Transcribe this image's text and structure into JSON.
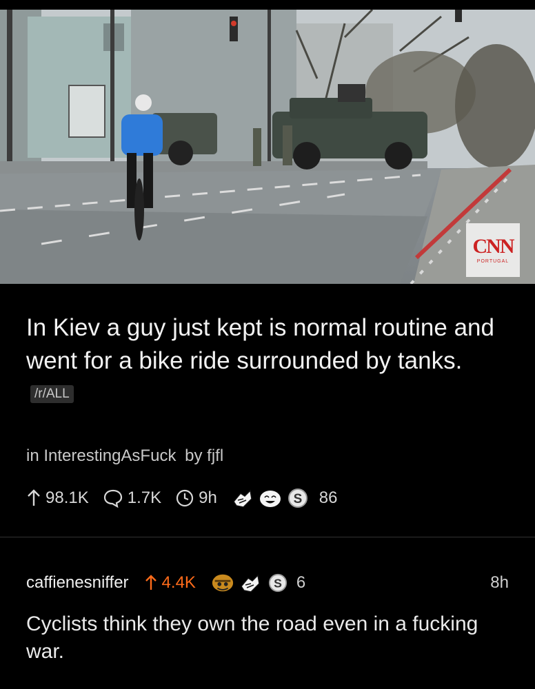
{
  "photo": {
    "watermark": {
      "logo": "CNN",
      "subtitle": "PORTUGAL"
    }
  },
  "post": {
    "title": "In Kiev a guy just kept is normal routine and went for a bike ride surrounded by tanks.",
    "flair": "/r/ALL",
    "subreddit_prefix": "in",
    "subreddit": "InterestingAsFuck",
    "author_prefix": "by",
    "author": "fjfl",
    "upvotes": "98.1K",
    "comments": "1.7K",
    "age": "9h",
    "awards": [
      "wholesome-hands-award-icon",
      "laughing-face-award-icon",
      "silver-award-icon"
    ],
    "award_count": "86"
  },
  "comment": {
    "username": "caffienesniffer",
    "score": "4.4K",
    "awards": [
      "helmet-face-award-icon",
      "wholesome-hands-award-icon",
      "silver-award-icon"
    ],
    "award_count": "6",
    "age": "8h",
    "body": "Cyclists think they own the road even in a fucking war."
  },
  "colors": {
    "background": "#000000",
    "upvote_accent": "#ff6b1a",
    "text": "#f2f2f2",
    "muted": "#c9c9c9"
  }
}
